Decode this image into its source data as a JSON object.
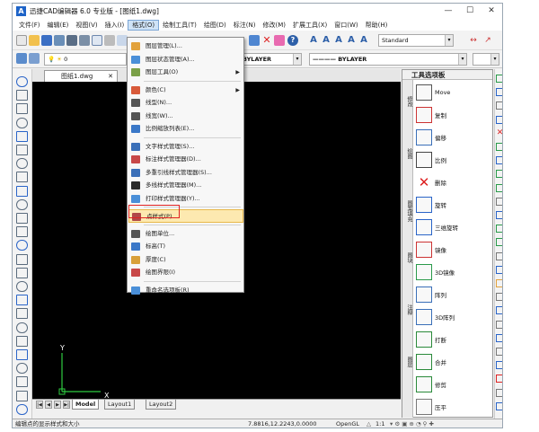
{
  "app": {
    "logo": "A",
    "title": "迅捷CAD编辑器 6.0 专业版 - [图纸1.dwg]",
    "window_buttons": [
      "—",
      "☐",
      "✕"
    ]
  },
  "menubar": [
    "文件(F)",
    "编辑(E)",
    "视图(V)",
    "插入(I)",
    "格式(O)",
    "绘制工具(T)",
    "绘图(D)",
    "标注(N)",
    "修改(M)",
    "扩展工具(X)",
    "窗口(W)",
    "帮助(H)"
  ],
  "menubar_active": "格式(O)",
  "toolbar": {
    "textstyle_value": "Standard",
    "layer_value": "0",
    "color_value": "BYLAYER",
    "linetype_value": "———— BYLAYER"
  },
  "document": {
    "tab_label": "图纸1.dwg",
    "tab_close": "✕"
  },
  "layout_tabs": [
    "Model",
    "Layout1",
    "Layout2"
  ],
  "layout_nav": [
    "|◀",
    "◀",
    "▶",
    "▶|"
  ],
  "canvas": {
    "ucs_y": "Y",
    "ucs_x": "X"
  },
  "status": {
    "message": "编辑点的显示样式和大小",
    "coords": "7.8816,12.2243,0.0000",
    "mode": "OpenGL",
    "scale": "1:1"
  },
  "format_menu": [
    {
      "label": "图层管理(L)...",
      "icon": "layers-icon",
      "color": "#e2a23c"
    },
    {
      "label": "图层状态管理(A)...",
      "icon": "layer-state-icon",
      "color": "#4a8fd8"
    },
    {
      "label": "图层工具(O)",
      "icon": "layer-tools-icon",
      "color": "#7aa048",
      "submenu": true
    },
    {
      "sep": true
    },
    {
      "label": "颜色(C)",
      "icon": "color-icon",
      "color": "#d85a3a",
      "submenu": true
    },
    {
      "label": "线型(N)...",
      "icon": "linetype-icon",
      "color": "#555555"
    },
    {
      "label": "线宽(W)...",
      "icon": "lineweight-icon",
      "color": "#555555"
    },
    {
      "label": "比例缩放列表(E)...",
      "icon": "scale-list-icon",
      "color": "#3a78c8"
    },
    {
      "sep": true
    },
    {
      "label": "文字样式管理(S)...",
      "icon": "text-style-icon",
      "color": "#3a6fb8"
    },
    {
      "label": "标注样式管理器(D)...",
      "icon": "dim-style-icon",
      "color": "#c84848"
    },
    {
      "label": "多重引线样式管理器(S)...",
      "icon": "mleader-style-icon",
      "color": "#3a6fb8"
    },
    {
      "label": "多线样式管理器(M)...",
      "icon": "mline-style-icon",
      "color": "#2a2a2a"
    },
    {
      "label": "打印样式管理器(Y)...",
      "icon": "plot-style-icon",
      "color": "#4a8fd8"
    },
    {
      "sep": true
    },
    {
      "label": "点样式(P)...",
      "icon": "point-style-icon",
      "color": "#b04848",
      "highlight": true
    },
    {
      "sep": true
    },
    {
      "label": "绘图单位...",
      "icon": "units-icon",
      "color": "#555555"
    },
    {
      "label": "标高(T)",
      "icon": "elevation-icon",
      "color": "#3a78c8"
    },
    {
      "label": "厚度(C)",
      "icon": "thickness-icon",
      "color": "#d8a03a"
    },
    {
      "label": "绘图界限(I)",
      "icon": "limits-icon",
      "color": "#c84848"
    },
    {
      "sep": true
    },
    {
      "label": "重命名选项板(R)",
      "icon": "rename-icon",
      "color": "#4a8fd8"
    }
  ],
  "tool_palette": {
    "title": "工具选项板",
    "vertical_tabs": [
      "修改",
      "绘图",
      "图案填充",
      "图块",
      "注释",
      "图层"
    ],
    "items": [
      {
        "label": "Move",
        "icon": "move-icon"
      },
      {
        "label": "复制",
        "icon": "copy-icon"
      },
      {
        "label": "偏移",
        "icon": "offset-icon"
      },
      {
        "label": "比例",
        "icon": "scale-icon"
      },
      {
        "label": "删除",
        "icon": "delete-icon"
      },
      {
        "label": "旋转",
        "icon": "rotate-icon"
      },
      {
        "label": "三维旋转",
        "icon": "rotate3d-icon"
      },
      {
        "label": "镜像",
        "icon": "mirror-icon"
      },
      {
        "label": "3D镜像",
        "icon": "mirror3d-icon"
      },
      {
        "label": "阵列",
        "icon": "array-icon"
      },
      {
        "label": "3D阵列",
        "icon": "array3d-icon"
      },
      {
        "label": "打断",
        "icon": "break-icon"
      },
      {
        "label": "合并",
        "icon": "join-icon"
      },
      {
        "label": "修剪",
        "icon": "trim-icon"
      },
      {
        "label": "压平",
        "icon": "flatten-icon"
      }
    ]
  },
  "colors": {
    "highlight_border": "#e02222",
    "menu_highlight": "#fde9b0",
    "canvas": "#000000",
    "accent_blue": "#1e64c8"
  }
}
